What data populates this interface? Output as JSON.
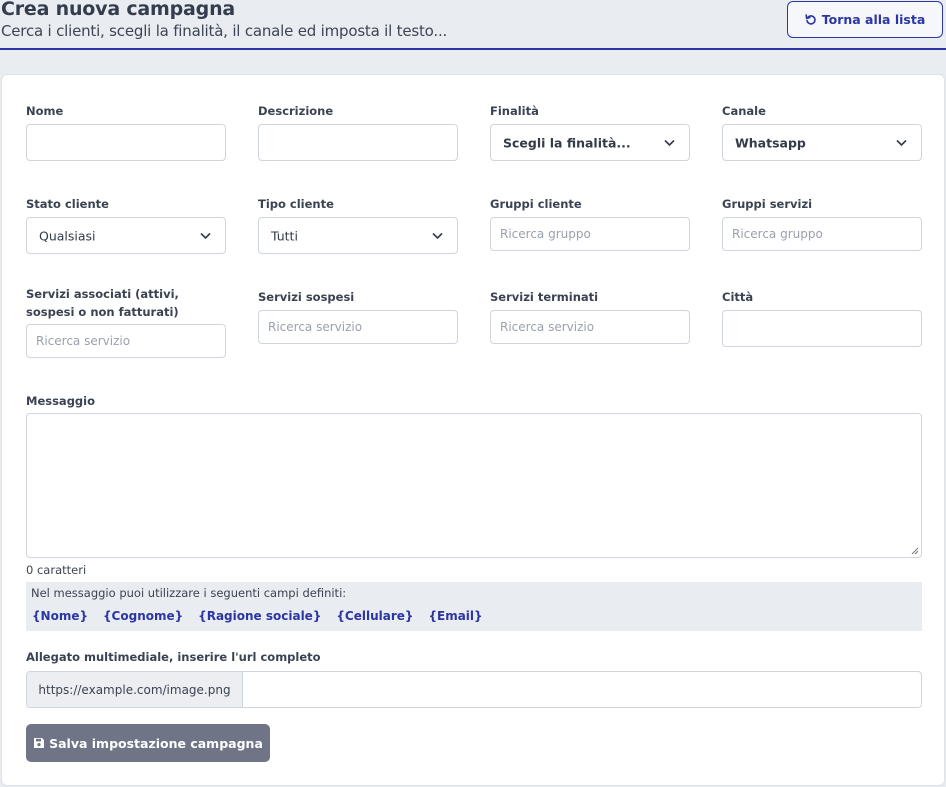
{
  "header": {
    "title": "Crea nuova campagna",
    "subtitle": "Cerca i clienti, scegli la finalità, il canale ed imposta il testo...",
    "back_button": {
      "label": "Torna alla lista",
      "icon": "undo-icon"
    }
  },
  "form": {
    "nome": {
      "label": "Nome",
      "value": ""
    },
    "descrizione": {
      "label": "Descrizione",
      "value": ""
    },
    "finalita": {
      "label": "Finalità",
      "selected": "Scegli la finalità..."
    },
    "canale": {
      "label": "Canale",
      "selected": "Whatsapp"
    },
    "stato_cliente": {
      "label": "Stato cliente",
      "selected": "Qualsiasi"
    },
    "tipo_cliente": {
      "label": "Tipo cliente",
      "selected": "Tutti"
    },
    "gruppi_cliente": {
      "label": "Gruppi cliente",
      "placeholder": "Ricerca gruppo"
    },
    "gruppi_servizi": {
      "label": "Gruppi servizi",
      "placeholder": "Ricerca gruppo"
    },
    "servizi_associati": {
      "label": "Servizi associati (attivi, sospesi o non fatturati)",
      "placeholder": "Ricerca servizio"
    },
    "servizi_sospesi": {
      "label": "Servizi sospesi",
      "placeholder": "Ricerca servizio"
    },
    "servizi_terminati": {
      "label": "Servizi terminati",
      "placeholder": "Ricerca servizio"
    },
    "citta": {
      "label": "Città",
      "value": ""
    },
    "messaggio": {
      "label": "Messaggio",
      "value": "",
      "char_count": "0 caratteri"
    },
    "available_fields": {
      "hint": "Nel messaggio puoi utilizzare i seguenti campi definiti:",
      "tokens": [
        "{Nome}",
        "{Cognome}",
        "{Ragione sociale}",
        "{Cellulare}",
        "{Email}"
      ]
    },
    "allegato": {
      "label": "Allegato multimediale, inserire l'url completo",
      "prefix": "https://example.com/image.png",
      "value": ""
    },
    "save_button": {
      "label": "Salva impostazione campagna",
      "icon": "floppy-disk-icon"
    }
  },
  "colors": {
    "accent": "#2b36a3",
    "page_background": "#e9ecf1",
    "save_button": "#6f7587"
  }
}
